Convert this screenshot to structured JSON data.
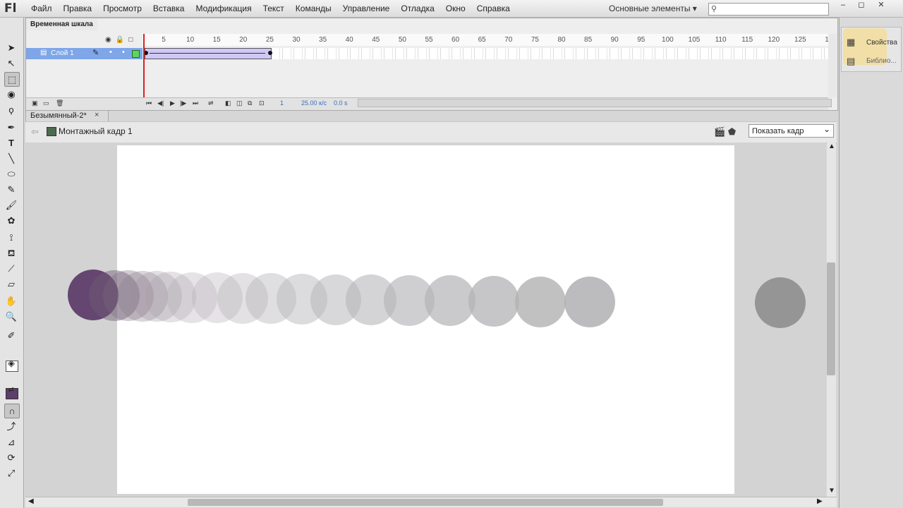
{
  "app": {
    "logo": "Fl"
  },
  "menu": {
    "items": [
      "Файл",
      "Правка",
      "Просмотр",
      "Вставка",
      "Модификация",
      "Текст",
      "Команды",
      "Управление",
      "Отладка",
      "Окно",
      "Справка"
    ]
  },
  "workspace": {
    "label": "Основные элементы ▾"
  },
  "window_controls": {
    "minimize": "‒",
    "restore": "◻",
    "close": "✕"
  },
  "toolbar": {
    "tools": [
      "selection-tool",
      "subselection-tool",
      "free-transform-tool",
      "3d-rotation-tool",
      "lasso-tool",
      "pen-tool",
      "text-tool",
      "line-tool",
      "oval-tool",
      "pencil-tool",
      "brush-tool",
      "deco-tool",
      "bone-tool",
      "paint-bucket-tool",
      "eyedropper-tool",
      "eraser-tool",
      "hand-tool",
      "zoom-tool"
    ]
  },
  "timeline": {
    "tab_label": "Временная шкала",
    "layer_name": "Слой 1",
    "frame_numbers": [
      "5",
      "10",
      "15",
      "20",
      "25",
      "30",
      "35",
      "40",
      "45",
      "50",
      "55",
      "60",
      "65",
      "70",
      "75",
      "80",
      "85",
      "90",
      "95",
      "100",
      "105",
      "110",
      "115",
      "120",
      "125",
      "1"
    ],
    "current_frame": "1",
    "fps": "25.00 к/с",
    "time": "0.0 s",
    "tween_end_frame": 25
  },
  "right_panel": {
    "properties_label": "Свойства",
    "library_label": "Библио..."
  },
  "document": {
    "tab_title": "Безымянный-2*",
    "tab_close": "×",
    "scene_label": "Монтажный кадр 1",
    "zoom_value": "Показать кадр",
    "zoom_chevron": "⌄"
  },
  "colors": {
    "fill": "#5e3e6a",
    "onion_skin": "#c4bcc6",
    "tween_end": "#959595"
  },
  "stage_circles": [
    {
      "color": "#5e3e6a",
      "opacity": 0.95
    },
    {
      "color": "#6f5a74",
      "opacity": 0.45
    },
    {
      "color": "#7a6a7e",
      "opacity": 0.35
    },
    {
      "color": "#8a7c8d",
      "opacity": 0.32
    },
    {
      "color": "#9a8f9c",
      "opacity": 0.3
    },
    {
      "color": "#a79ea9",
      "opacity": 0.3
    },
    {
      "color": "#b0a9b2",
      "opacity": 0.32
    },
    {
      "color": "#b5b0b7",
      "opacity": 0.35
    },
    {
      "color": "#b8b4ba",
      "opacity": 0.4
    },
    {
      "color": "#b9b6bb",
      "opacity": 0.45
    },
    {
      "color": "#b9b7bb",
      "opacity": 0.5
    },
    {
      "color": "#b8b6ba",
      "opacity": 0.55
    },
    {
      "color": "#b7b5b9",
      "opacity": 0.6
    },
    {
      "color": "#b6b4b8",
      "opacity": 0.65
    },
    {
      "color": "#b4b3b6",
      "opacity": 0.7
    },
    {
      "color": "#b3b2b5",
      "opacity": 0.75
    },
    {
      "color": "#b2b1b3",
      "opacity": 0.8
    },
    {
      "color": "#b0afb1",
      "opacity": 0.85
    },
    {
      "color": "#959595",
      "opacity": 1
    }
  ]
}
